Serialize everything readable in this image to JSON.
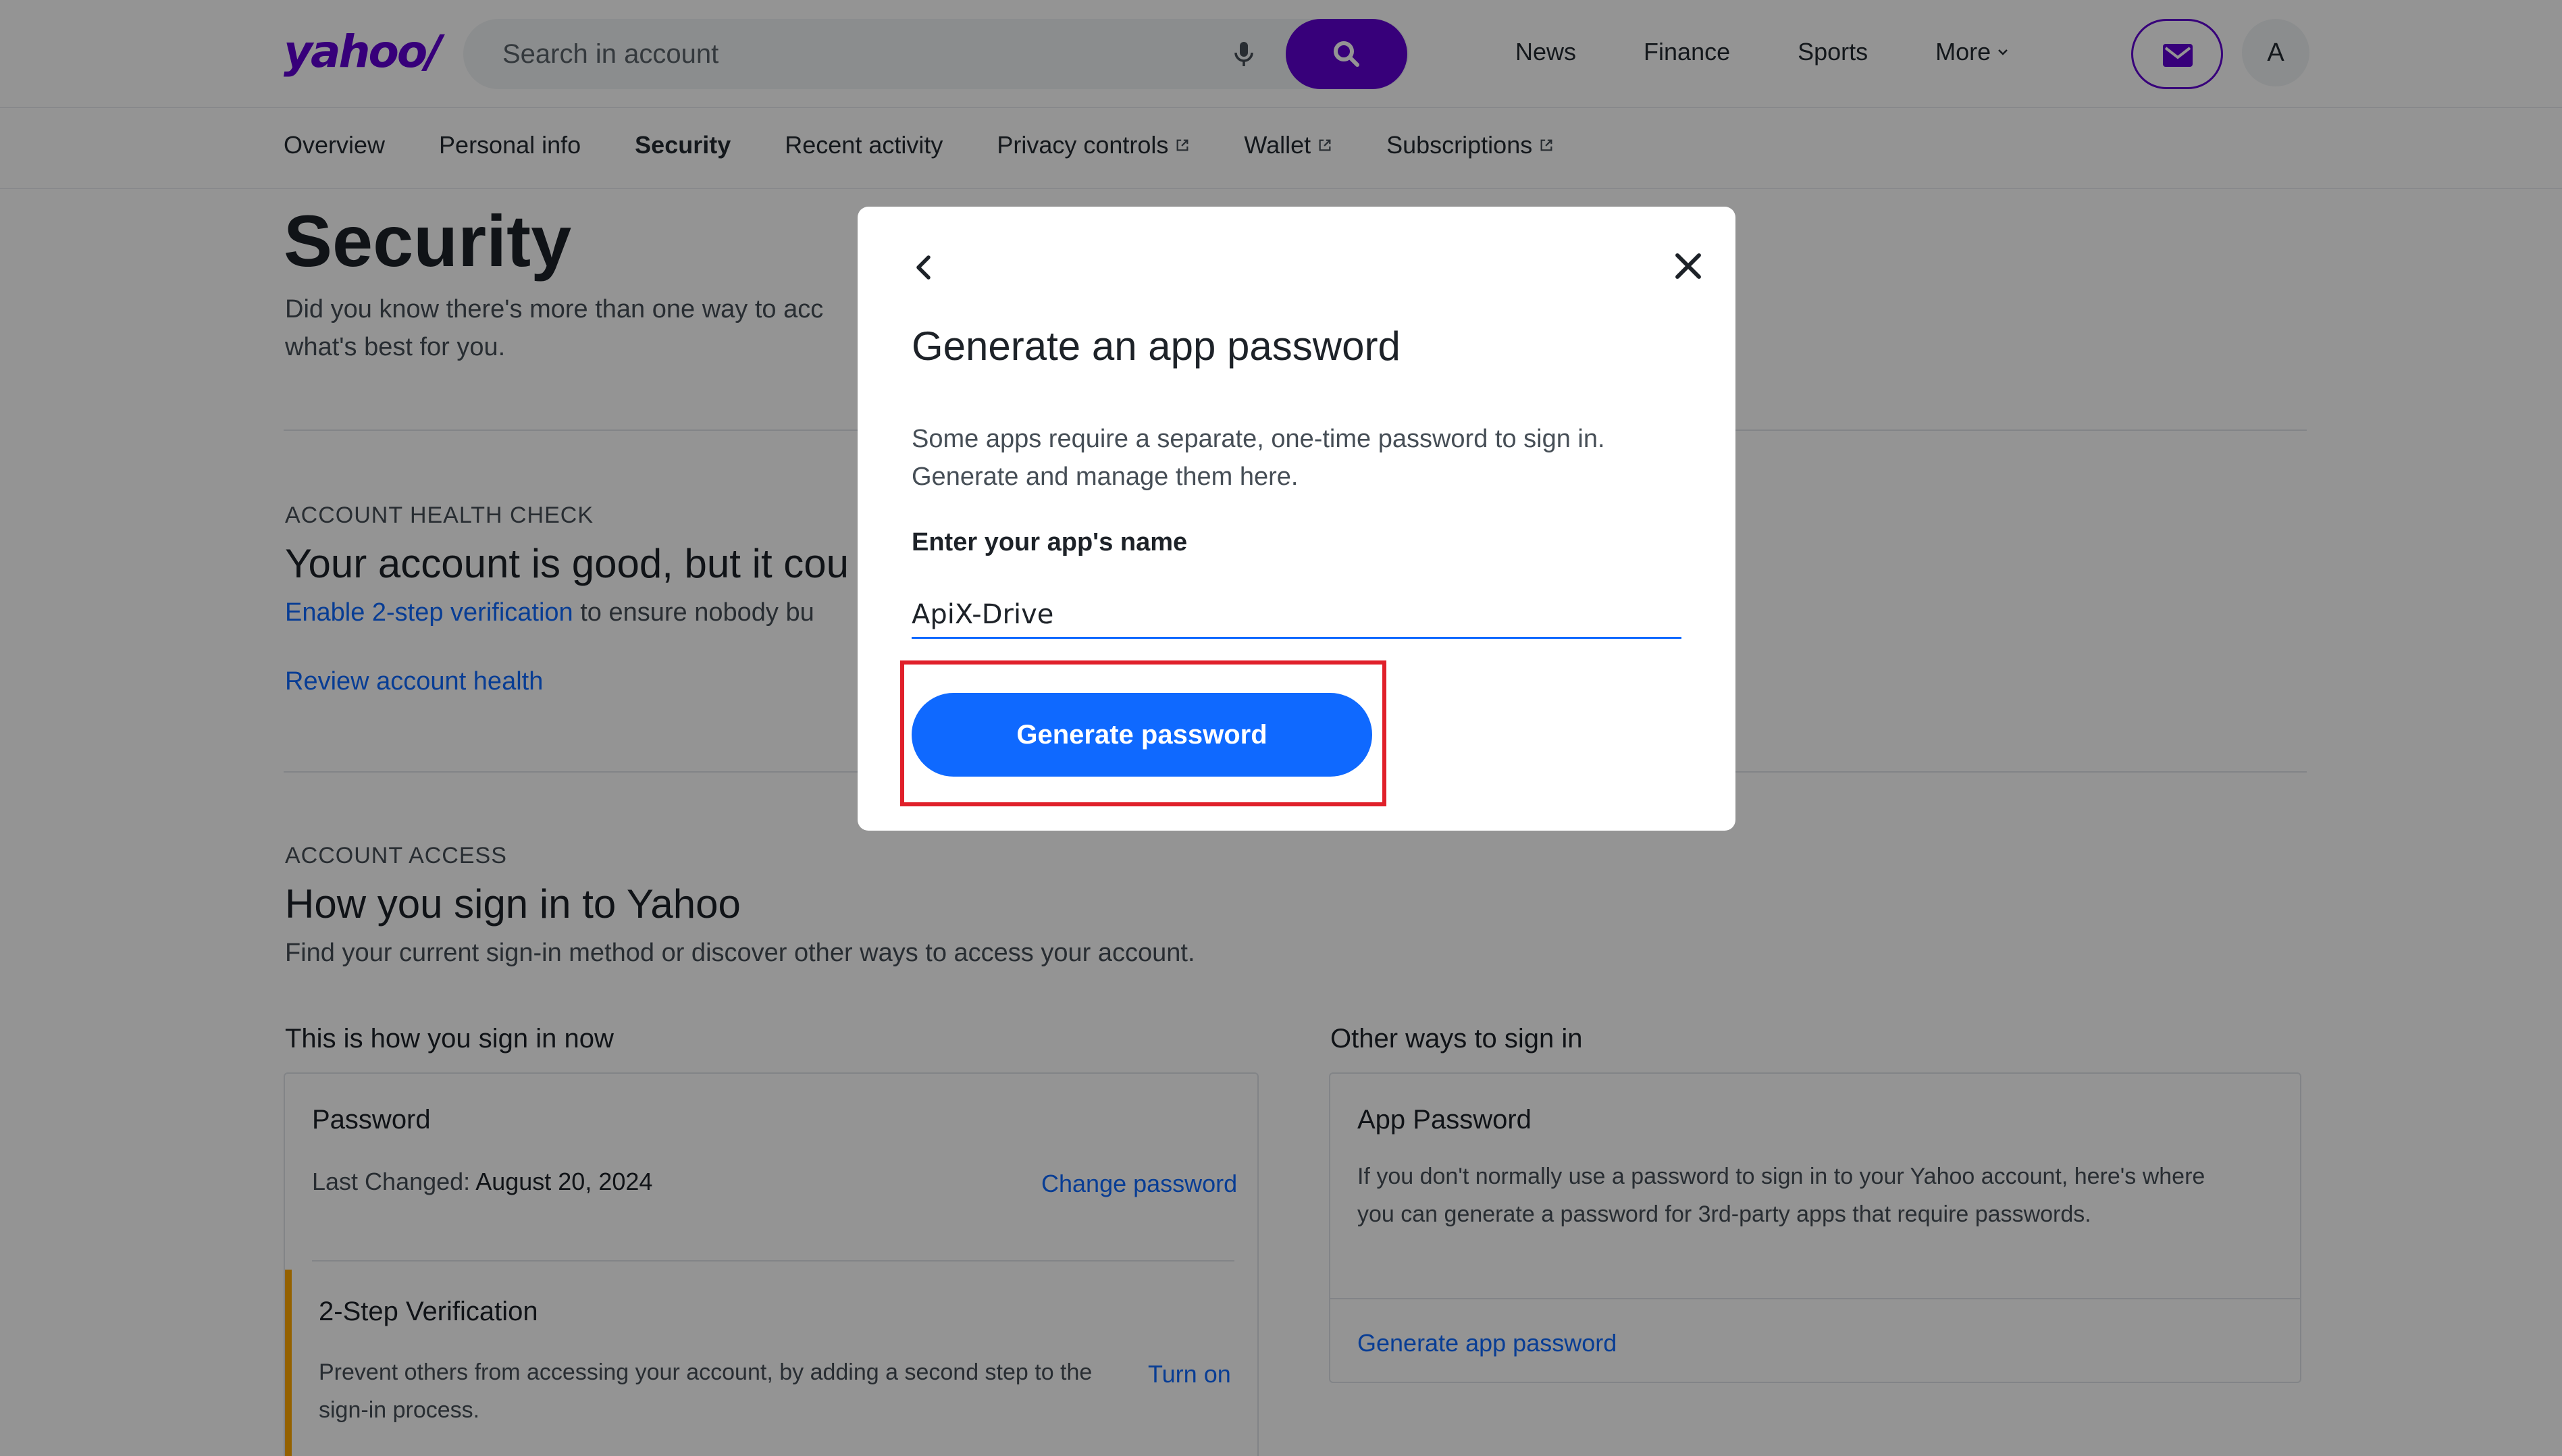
{
  "header": {
    "logo": "yahoo/",
    "search_placeholder": "Search in account",
    "nav": [
      "News",
      "Finance",
      "Sports",
      "More"
    ],
    "avatar_initial": "A"
  },
  "subnav": {
    "items": [
      "Overview",
      "Personal info",
      "Security",
      "Recent activity",
      "Privacy controls",
      "Wallet",
      "Subscriptions"
    ],
    "active": "Security"
  },
  "page": {
    "title": "Security",
    "description_line1": "Did you know there's more than one way to acc",
    "description_line2": "what's best for you."
  },
  "health": {
    "eyebrow": "ACCOUNT HEALTH CHECK",
    "title": "Your account is good, but it cou",
    "enable_link": "Enable 2-step verification",
    "enable_text": " to ensure nobody bu",
    "review_link": "Review account health"
  },
  "access": {
    "eyebrow": "ACCOUNT ACCESS",
    "title": "How you sign in to Yahoo",
    "text": "Find your current sign-in method or discover other ways to access your account.",
    "current_heading": "This is how you sign in now",
    "other_heading": "Other ways to sign in",
    "password_card": {
      "title": "Password",
      "changed_label": "Last Changed:",
      "changed_value": "August 20, 2024",
      "change_link": "Change password"
    },
    "two_step_card": {
      "title": "2-Step Verification",
      "text_line1": "Prevent others from accessing your account, by adding a second step to the",
      "text_line2": "sign-in process.",
      "turn_on_link": "Turn on"
    },
    "app_password_card": {
      "title": "App Password",
      "text_line1": "If you don't normally use a password to sign in to your Yahoo account, here's where",
      "text_line2": "you can generate a password for 3rd-party apps that require passwords.",
      "generate_link": "Generate app password"
    }
  },
  "modal": {
    "title": "Generate an app password",
    "description_line1": "Some apps require a separate, one-time password to sign in.",
    "description_line2": "Generate and manage them here.",
    "label": "Enter your app's name",
    "app_name_value": "ApiX-Drive",
    "button_label": "Generate password"
  },
  "colors": {
    "brand": "#6001d2",
    "link": "#0f69ff",
    "highlight": "#e0202a",
    "warning_bar": "#ffa700"
  }
}
